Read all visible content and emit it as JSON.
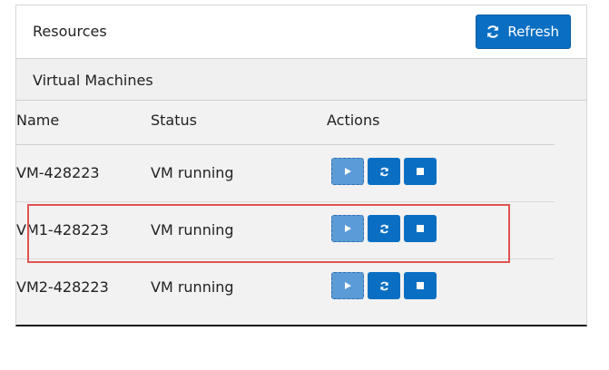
{
  "panel": {
    "title": "Resources",
    "refresh_label": "Refresh"
  },
  "section": {
    "title": "Virtual Machines"
  },
  "table": {
    "headers": {
      "name": "Name",
      "status": "Status",
      "actions": "Actions"
    },
    "rows": [
      {
        "name": "VM-428223",
        "status": "VM running"
      },
      {
        "name": "VM1-428223",
        "status": "VM running"
      },
      {
        "name": "VM2-428223",
        "status": "VM running"
      }
    ]
  },
  "colors": {
    "accent": "#0a6fc2",
    "disabled_accent": "#5b9bd6",
    "highlight": "#e05353"
  },
  "icons": {
    "refresh": "refresh-icon",
    "start": "play-icon",
    "restart": "restart-icon",
    "stop": "stop-icon"
  }
}
